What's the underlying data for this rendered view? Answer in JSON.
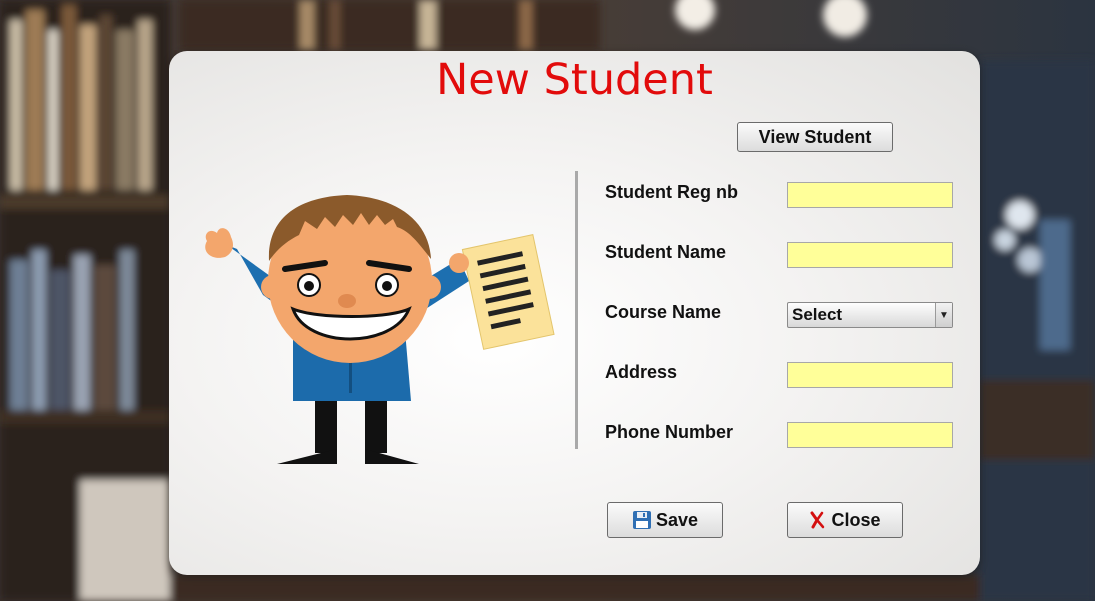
{
  "window": {
    "title": "New Student"
  },
  "toolbar": {
    "view_label": "View Student"
  },
  "form": {
    "reg_label": "Student Reg nb",
    "name_label": "Student Name",
    "course_label": "Course Name",
    "address_label": "Address",
    "phone_label": "Phone Number",
    "reg_value": "",
    "name_value": "",
    "address_value": "",
    "phone_value": "",
    "course_selected": "Select"
  },
  "actions": {
    "save_label": "Save",
    "close_label": "Close"
  },
  "colors": {
    "title": "#e20b0b",
    "field_bg": "#ffff99"
  },
  "icons": {
    "save": "floppy-disk-icon",
    "close": "red-x-icon",
    "dropdown": "triangle-down-icon"
  }
}
